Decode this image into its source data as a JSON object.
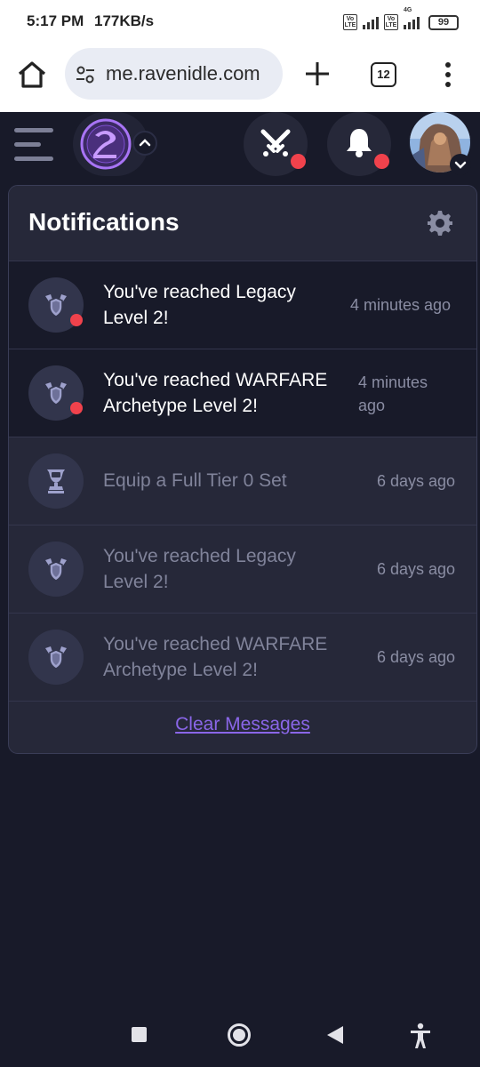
{
  "status_bar": {
    "time": "5:17 PM",
    "speed": "177KB/s",
    "volte1": "Vo LTE",
    "volte2": "Vo LTE",
    "network": "4G",
    "battery": "99"
  },
  "browser": {
    "url": "me.ravenidle.com",
    "tab_count": "12",
    "icons": [
      "home-icon",
      "site-settings-icon",
      "new-tab-icon",
      "tab-switcher",
      "more-menu-icon"
    ]
  },
  "header": {
    "icons": [
      "menu-icon",
      "raven-logo",
      "chevron-up-icon",
      "crossed-swords-icon",
      "bell-icon",
      "avatar",
      "chevron-down-icon"
    ],
    "alert_color": "#f0424c"
  },
  "notifications": {
    "title": "Notifications",
    "items": [
      {
        "text": "You've reached Legacy Level 2!",
        "time": "4 minutes ago",
        "unread": true,
        "icon": "shield-icon"
      },
      {
        "text": "You've reached WARFARE Archetype Level 2!",
        "time": "4 minutes ago",
        "unread": true,
        "icon": "shield-icon"
      },
      {
        "text": "Equip a Full Tier 0 Set",
        "time": "6 days ago",
        "unread": false,
        "icon": "trophy-icon"
      },
      {
        "text": "You've reached Legacy Level 2!",
        "time": "6 days ago",
        "unread": false,
        "icon": "shield-icon"
      },
      {
        "text": "You've reached WARFARE Archetype Level 2!",
        "time": "6 days ago",
        "unread": false,
        "icon": "shield-icon"
      }
    ],
    "clear_label": "Clear Messages"
  },
  "colors": {
    "background": "#181a29",
    "panel": "#262839",
    "accent": "#8a66e8",
    "unread_dot": "#f0424c"
  }
}
